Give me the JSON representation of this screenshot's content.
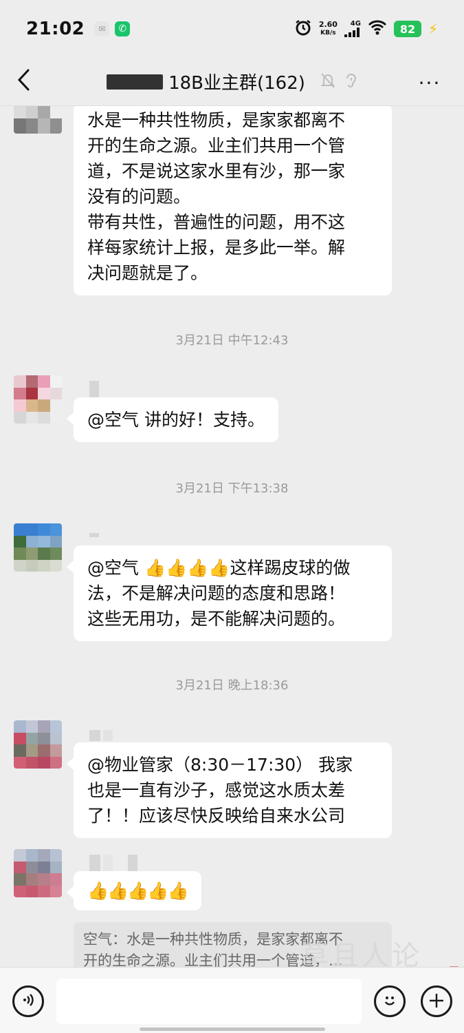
{
  "status_bar": {
    "time": "21:02",
    "net_speed_value": "2.60",
    "net_speed_unit": "KB/s",
    "network_type": "4G",
    "battery": "82",
    "accent": "#26c15a"
  },
  "header": {
    "title": "18B业主群(162)",
    "more_label": "···"
  },
  "messages": [
    {
      "text_lines": [
        "水是一种共性物质，是家家都离不",
        "开的生命之源。业主们共用一个管",
        "道，不是说这家水里有沙，那一家",
        "没有的问题。",
        "带有共性，普遍性的问题，用不这",
        "样每家统计上报，是多此一举。解",
        "决问题就是了。"
      ]
    },
    {
      "timestamp": "3月21日 中午12:43"
    },
    {
      "text": "@空气  讲的好！支持。"
    },
    {
      "timestamp": "3月21日 下午13:38"
    },
    {
      "text_lines": [
        "@空气 👍👍👍👍这样踢皮球的做",
        "法，不是解决问题的态度和思路！",
        "这些无用功，是不能解决问题的。"
      ]
    },
    {
      "timestamp": "3月21日 晚上18:36"
    },
    {
      "text_lines": [
        "@物业管家（8:30－17:30）  我家",
        "也是一直有沙子，感觉这水质太差",
        "了！！应该尽快反映给自来水公司"
      ]
    },
    {
      "text": "👍👍👍👍👍",
      "quote_lines": [
        "空气：水是一种共性物质，是家家都离不",
        "开的生命之源。业主们共用一个管道，…"
      ]
    }
  ],
  "watermark": "草且人论坛",
  "icons": {
    "back": "back-arrow-icon",
    "mute": "bell-off-icon",
    "ear": "ear-icon",
    "voice": "voice-icon",
    "emoji": "emoji-icon",
    "plus": "plus-icon"
  }
}
